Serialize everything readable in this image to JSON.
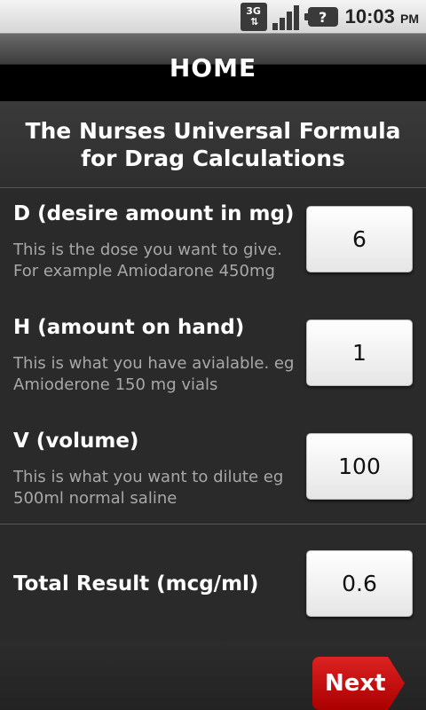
{
  "status_bar": {
    "network": "3G",
    "battery_label": "?",
    "time": "10:03",
    "ampm": "PM"
  },
  "header": {
    "title": "HOME"
  },
  "heading": {
    "text": "The Nurses Universal Formula for Drag Calculations"
  },
  "fields": [
    {
      "label": "D (desire amount in mg)",
      "description": "This is the dose you want to give. For example Amiodarone 450mg",
      "value": "6"
    },
    {
      "label": "H (amount on hand)",
      "description": "This is what you have avialable.  eg Amioderone 150 mg vials",
      "value": "1"
    },
    {
      "label": "V (volume)",
      "description": "This is what you want to dilute eg 500ml  normal saline",
      "value": "100"
    }
  ],
  "result": {
    "label": "Total Result (mcg/ml)",
    "value": "0.6"
  },
  "next_button": {
    "label": "Next"
  },
  "colors": {
    "accent": "#cc1111",
    "background": "#2a2a2a"
  }
}
